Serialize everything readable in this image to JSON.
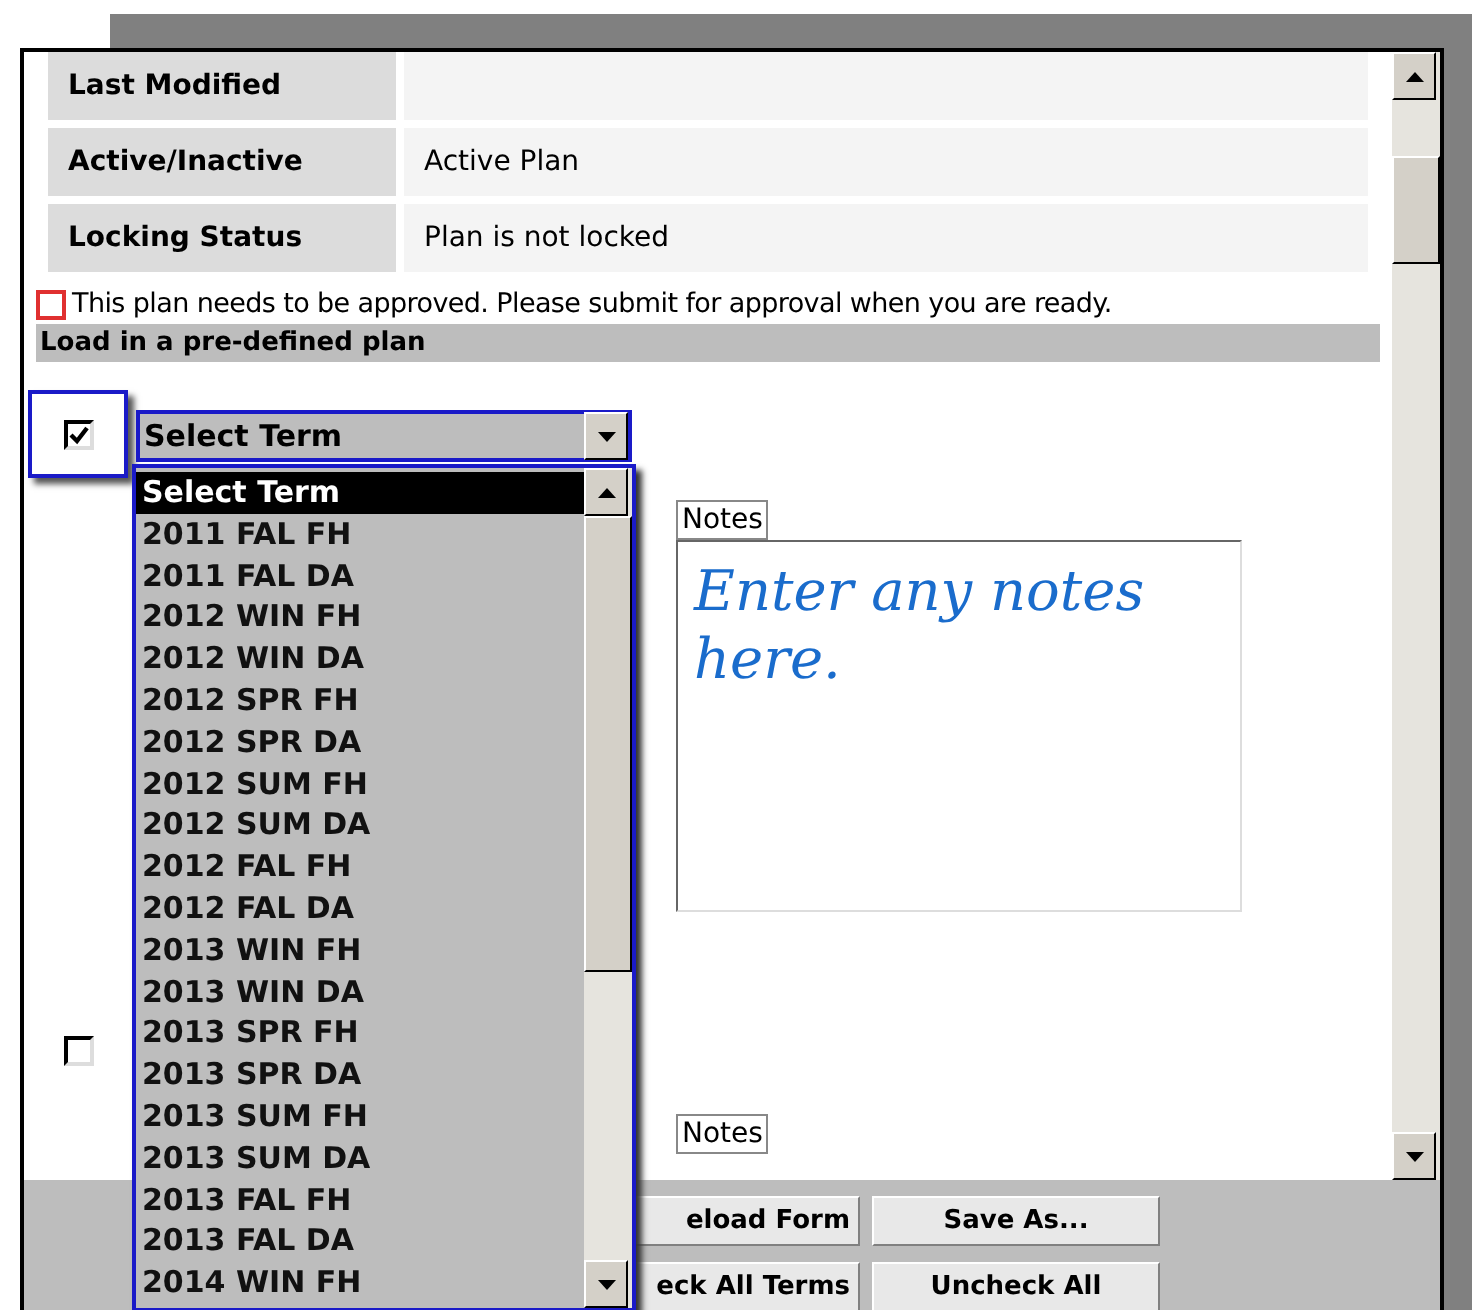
{
  "details": [
    {
      "label": "Last Modified"
    },
    {
      "label": "Active/Inactive",
      "value": "Active Plan"
    },
    {
      "label": "Locking Status",
      "value": "Plan is not locked"
    }
  ],
  "notice": {
    "checked": false,
    "text": "This plan needs to be approved. Please submit for approval when you are ready."
  },
  "section_title": "Load in a pre-defined plan",
  "plans": [
    {
      "checked": true,
      "select": {
        "value": "Select Term",
        "expanded": true,
        "options": [
          {
            "label": "Select Term",
            "selected": true
          },
          {
            "label": "2011 FAL FH",
            "selected": false
          },
          {
            "label": "2011 FAL DA",
            "selected": false
          },
          {
            "label": "2012 WIN FH",
            "selected": false
          },
          {
            "label": "2012 WIN DA",
            "selected": false
          },
          {
            "label": "2012 SPR FH",
            "selected": false
          },
          {
            "label": "2012 SPR DA",
            "selected": false
          },
          {
            "label": "2012 SUM FH",
            "selected": false
          },
          {
            "label": "2012 SUM DA",
            "selected": false
          },
          {
            "label": "2012 FAL FH",
            "selected": false
          },
          {
            "label": "2012 FAL DA",
            "selected": false
          },
          {
            "label": "2013 WIN FH",
            "selected": false
          },
          {
            "label": "2013 WIN DA",
            "selected": false
          },
          {
            "label": "2013 SPR FH",
            "selected": false
          },
          {
            "label": "2013 SPR DA",
            "selected": false
          },
          {
            "label": "2013 SUM FH",
            "selected": false
          },
          {
            "label": "2013 SUM DA",
            "selected": false
          },
          {
            "label": "2013 FAL FH",
            "selected": false
          },
          {
            "label": "2013 FAL DA",
            "selected": false
          },
          {
            "label": "2014 WIN FH",
            "selected": false
          }
        ]
      },
      "notes": {
        "label": "Notes",
        "placeholder": "Enter any notes here."
      }
    },
    {
      "checked": false,
      "notes": {
        "label": "Notes"
      }
    }
  ],
  "buttons": [
    [
      "eload Form",
      "Save As..."
    ],
    [
      "eck All Terms",
      "Uncheck All"
    ]
  ]
}
